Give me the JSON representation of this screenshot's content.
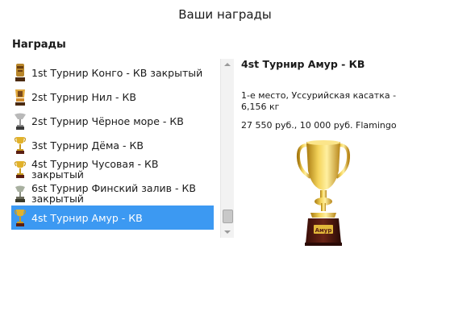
{
  "window": {
    "title": "Ваши награды"
  },
  "awards_section": {
    "label": "Награды"
  },
  "awards": [
    {
      "label": "1st Турнир Конго - КВ закрытый",
      "icon": "trophy-tiki-icon",
      "selected": false
    },
    {
      "label": "2st Турнир Нил - КВ",
      "icon": "trophy-pharaoh-icon",
      "selected": false
    },
    {
      "label": "2st Турнир Чёрное море - КВ",
      "icon": "trophy-silver-icon",
      "selected": false
    },
    {
      "label": "3st Турнир Дёма - КВ",
      "icon": "trophy-cup-icon",
      "selected": false
    },
    {
      "label": "4st Турнир Чусовая - КВ закрытый",
      "icon": "trophy-cup-icon",
      "selected": false
    },
    {
      "label": "6st Турнир Финский залив - КВ закрытый",
      "icon": "trophy-silver-icon",
      "selected": false
    },
    {
      "label": "4st Турнир Амур - КВ",
      "icon": "trophy-cup-icon",
      "selected": true
    }
  ],
  "detail": {
    "title": "4st Турнир Амур - КВ",
    "place_line": "1-е место, Уссурийская касатка - 6,156 кг",
    "prize_line": "27 550 руб., 10 000 руб. Flamingo",
    "trophy_engraving": "Амур"
  },
  "colors": {
    "selection": "#3c99f2",
    "gold": "#d9a91a",
    "base": "#5a1e12"
  }
}
